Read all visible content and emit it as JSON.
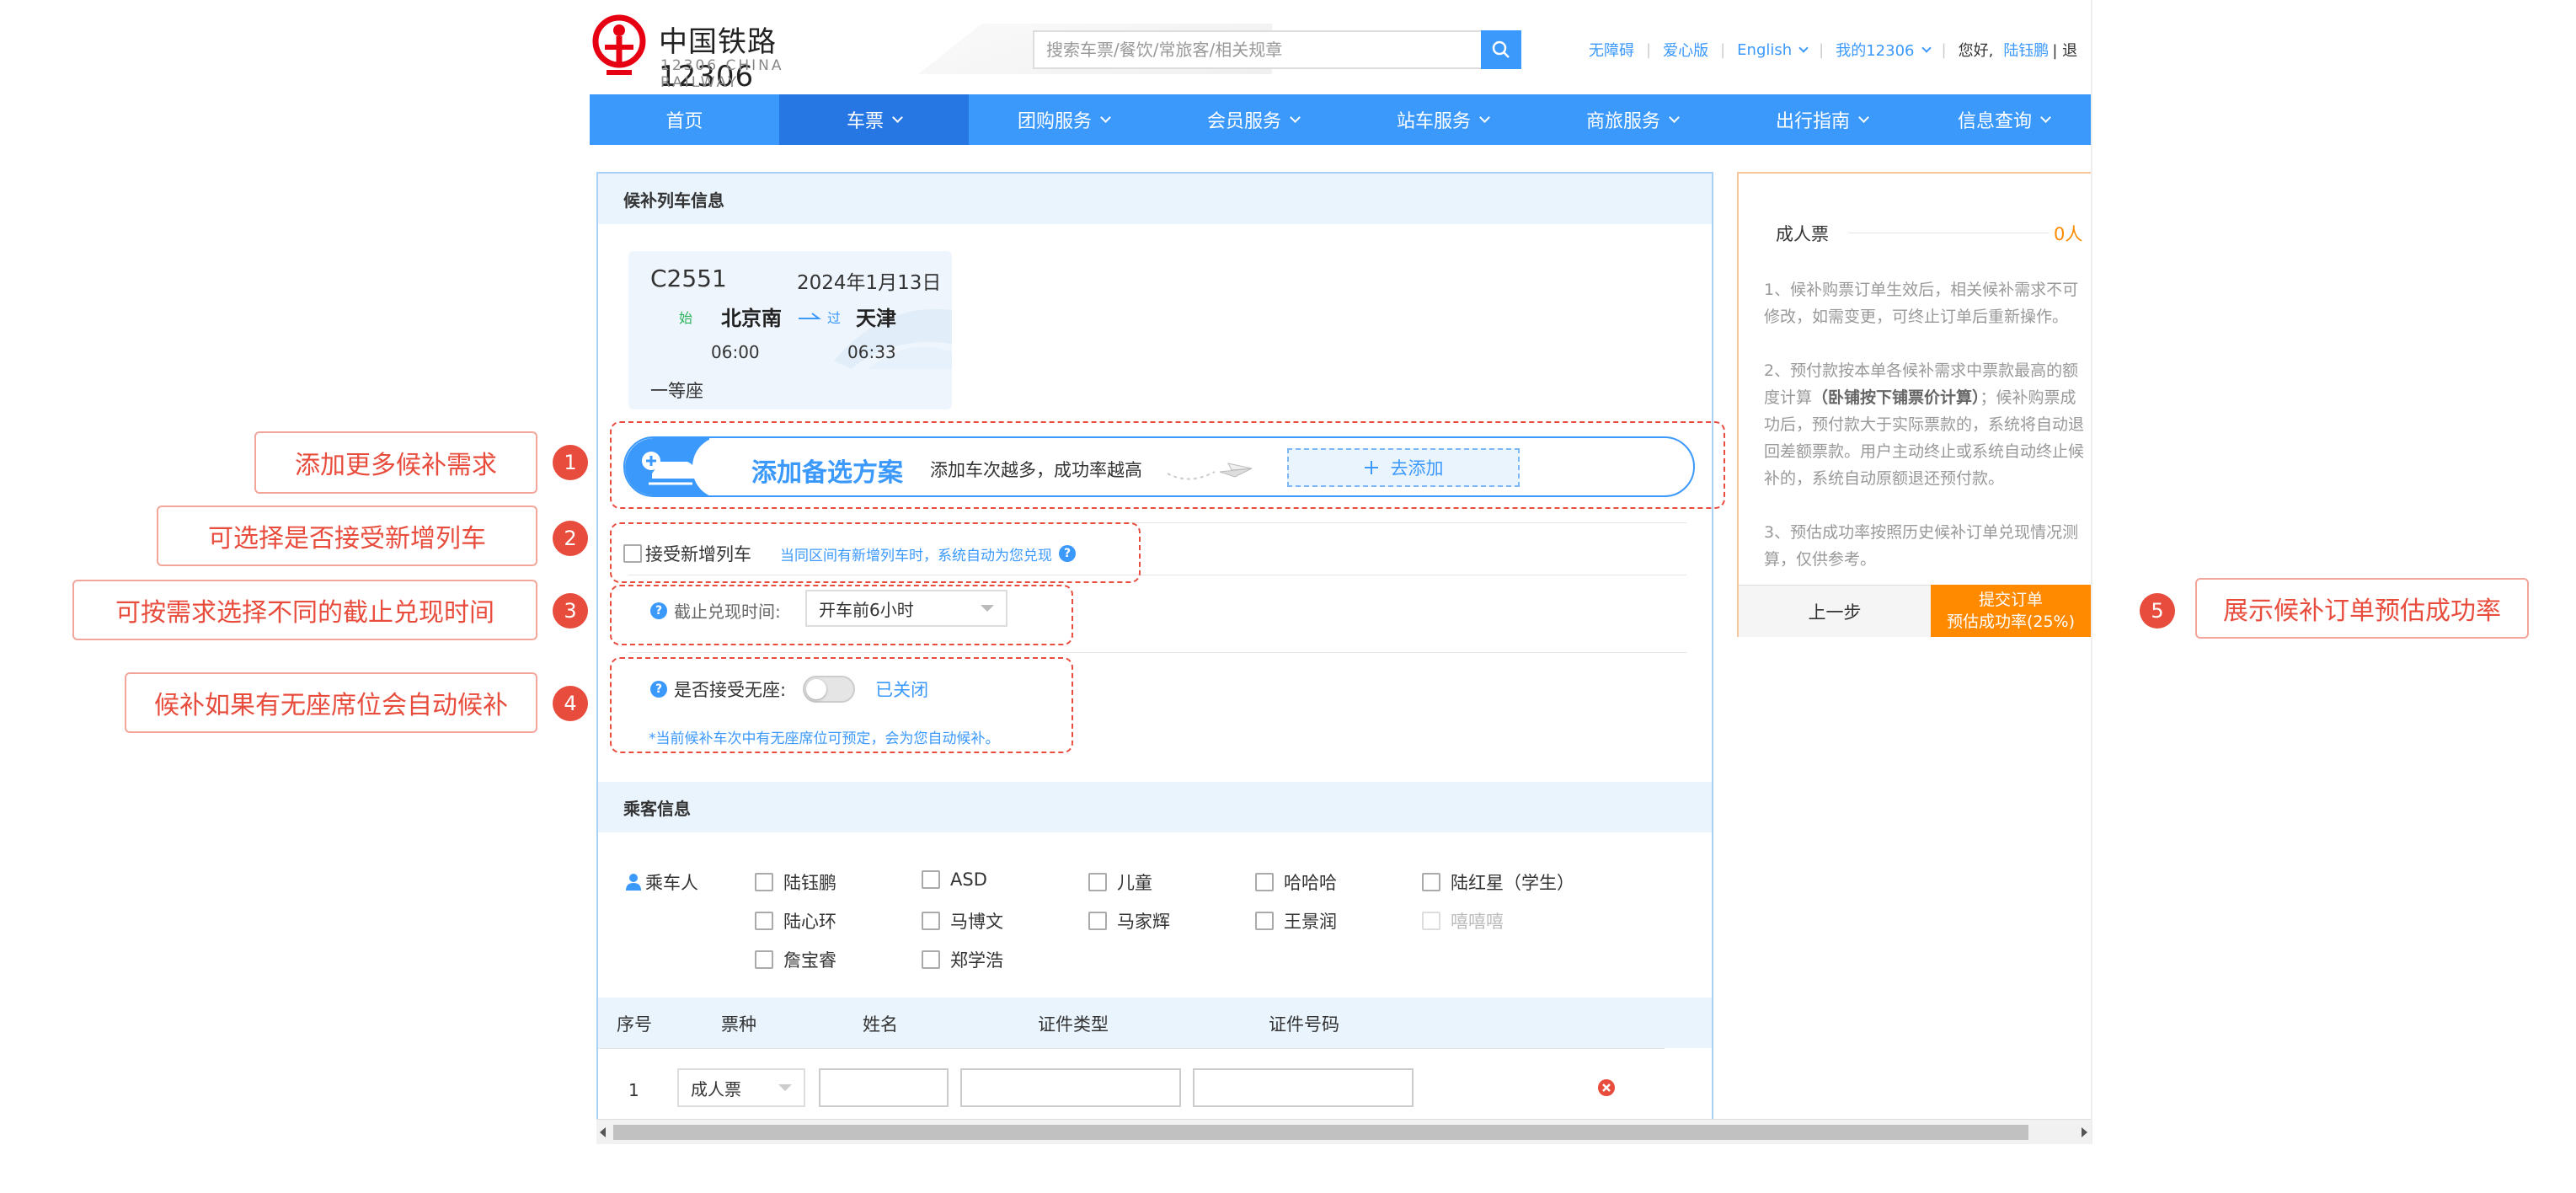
{
  "header": {
    "logo_title": "中国铁路12306",
    "logo_subtitle": "12306 CHINA RAILWAY",
    "search_placeholder": "搜索车票/餐饮/常旅客/相关规章",
    "links": [
      "无障碍",
      "爱心版",
      "English",
      "我的12306"
    ],
    "greeting": "您好,",
    "user": "陆钰鹏",
    "logout": "| 退"
  },
  "nav": {
    "items": [
      "首页",
      "车票",
      "团购服务",
      "会员服务",
      "站车服务",
      "商旅服务",
      "出行指南",
      "信息查询"
    ]
  },
  "train_section": {
    "title": "候补列车信息",
    "train_no": "C2551",
    "date": "2024年1月13日",
    "from_tag": "始",
    "from": "北京南",
    "via_tag": "过",
    "to": "天津",
    "depart_time": "06:00",
    "arrive_time": "06:33",
    "seat": "一等座"
  },
  "add_plan": {
    "title": "添加备选方案",
    "desc": "添加车次越多，成功率越高",
    "button": "去添加"
  },
  "accept_new": {
    "label": "接受新增列车",
    "hint": "当同区间有新增列车时，系统自动为您兑现"
  },
  "deadline": {
    "label": "截止兑现时间:",
    "value": "开车前6小时"
  },
  "no_seat": {
    "label": "是否接受无座:",
    "state": "已关闭",
    "hint": "*当前候补车次中有无座席位可预定，会为您自动候补。"
  },
  "passenger_section": {
    "title": "乘客信息",
    "label": "乘车人",
    "passengers": [
      {
        "name": "陆钰鹏",
        "disabled": false
      },
      {
        "name": "ASD",
        "disabled": false
      },
      {
        "name": "儿童",
        "disabled": false
      },
      {
        "name": "哈哈哈",
        "disabled": false
      },
      {
        "name": "陆红星（学生）",
        "disabled": false
      },
      {
        "name": "陆心环",
        "disabled": false
      },
      {
        "name": "马博文",
        "disabled": false
      },
      {
        "name": "马家辉",
        "disabled": false
      },
      {
        "name": "王景润",
        "disabled": false
      },
      {
        "name": "嘻嘻嘻",
        "disabled": true
      },
      {
        "name": "詹宝睿",
        "disabled": false
      },
      {
        "name": "郑学浩",
        "disabled": false
      }
    ]
  },
  "table": {
    "headers": [
      "序号",
      "票种",
      "姓名",
      "证件类型",
      "证件号码"
    ],
    "row": {
      "index": "1",
      "ticket_type": "成人票"
    }
  },
  "right_panel": {
    "ticket_label": "成人票",
    "ticket_count": "0人",
    "notes": [
      "1、候补购票订单生效后，相关候补需求不可修改，如需变更，可终止订单后重新操作。",
      "2、预付款按本单各候补需求中票款最高的额度计算（卧铺按下铺票价计算）；候补购票成功后，预付款大于实际票款的，系统将自动退回差额票款。用户主动终止或系统自动终止候补的，系统自动原额退还预付款。",
      "3、预估成功率按照历史候补订单兑现情况测算，仅供参考。"
    ],
    "prev_button": "上一步",
    "submit_line1": "提交订单",
    "submit_line2": "预估成功率(25%)"
  },
  "callouts": [
    {
      "num": "1",
      "text": "添加更多候补需求"
    },
    {
      "num": "2",
      "text": "可选择是否接受新增列车"
    },
    {
      "num": "3",
      "text": "可按需求选择不同的截止兑现时间"
    },
    {
      "num": "4",
      "text": "候补如果有无座席位会自动候补"
    },
    {
      "num": "5",
      "text": "展示候补订单预估成功率"
    }
  ],
  "colors": {
    "primary": "#3b99fc",
    "nav_active": "#2676e3",
    "accent_orange": "#ff8a00",
    "annotation_red": "#e84c3d"
  }
}
